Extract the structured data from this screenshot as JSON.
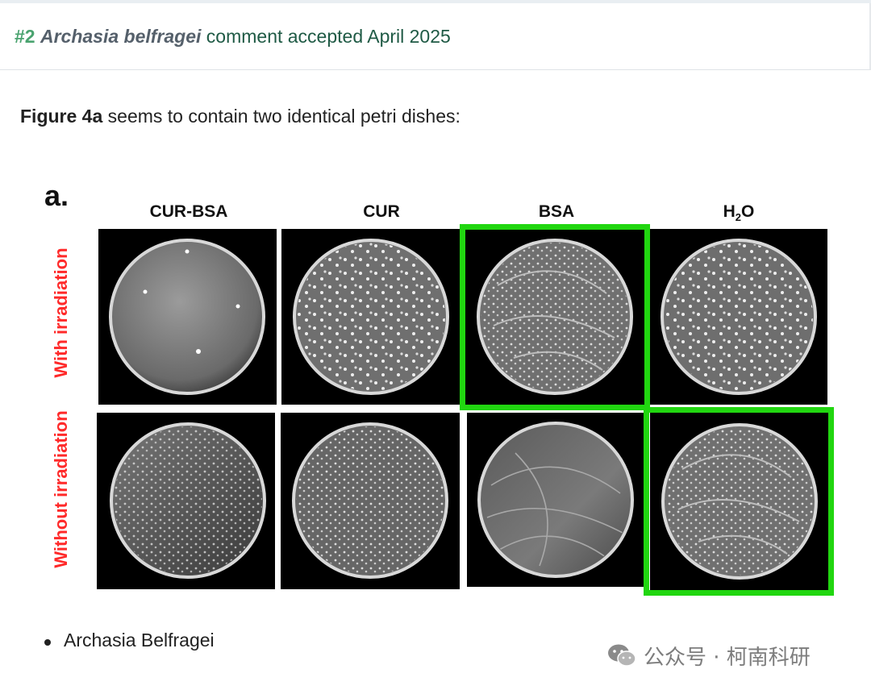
{
  "comment": {
    "number": "#2",
    "author": "Archasia belfragei",
    "status_text": "comment accepted April 2025"
  },
  "intro": {
    "bold": "Figure 4a",
    "text": " seems to contain two identical petri dishes:"
  },
  "figure": {
    "panel_letter": "a.",
    "columns": [
      "CUR-BSA",
      "CUR",
      "BSA",
      "H"
    ],
    "h2o_subscript": "2",
    "h2o_suffix": "O",
    "rows": [
      "With irradiation",
      "Without irradiation"
    ],
    "highlight_color": "#21d610",
    "row_label_color": "#ff2a2a"
  },
  "bullets": [
    "Archasia Belfragei"
  ],
  "watermark": {
    "icon": "wechat-icon",
    "text": "公众号 · 柯南科研"
  }
}
